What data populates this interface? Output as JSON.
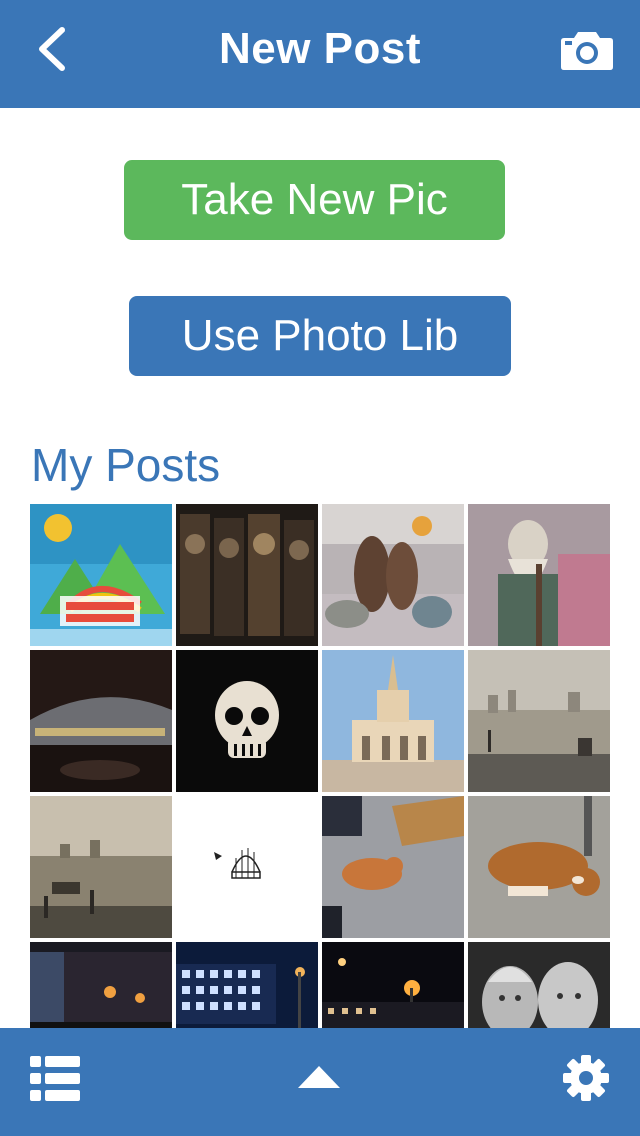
{
  "navbar": {
    "title": "New Post",
    "back_icon": "chevron-left-icon",
    "camera_icon": "camera-icon"
  },
  "actions": {
    "take_pic_label": "Take New Pic",
    "photo_lib_label": "Use Photo Lib"
  },
  "posts": {
    "title": "My Posts",
    "thumbnails": [
      "birthday-card-photo",
      "movie-posters-photo",
      "figurines-photo",
      "wizard-figure-photo",
      "stadium-night-photo",
      "skull-art-photo",
      "monument-building-photo",
      "lake-morning-photo",
      "lake-sunset-photo",
      "birdcage-drawing-photo",
      "dog-playing-photo",
      "dog-sleeping-photo",
      "campus-night-photo",
      "building-night-photo",
      "street-night-photo",
      "two-men-bw-photo"
    ]
  },
  "tabbar": {
    "list_icon": "list-icon",
    "up_icon": "triangle-up-icon",
    "settings_icon": "gear-icon"
  },
  "colors": {
    "primary": "#3a76b7",
    "success": "#5cb85c",
    "background": "#ffffff"
  }
}
